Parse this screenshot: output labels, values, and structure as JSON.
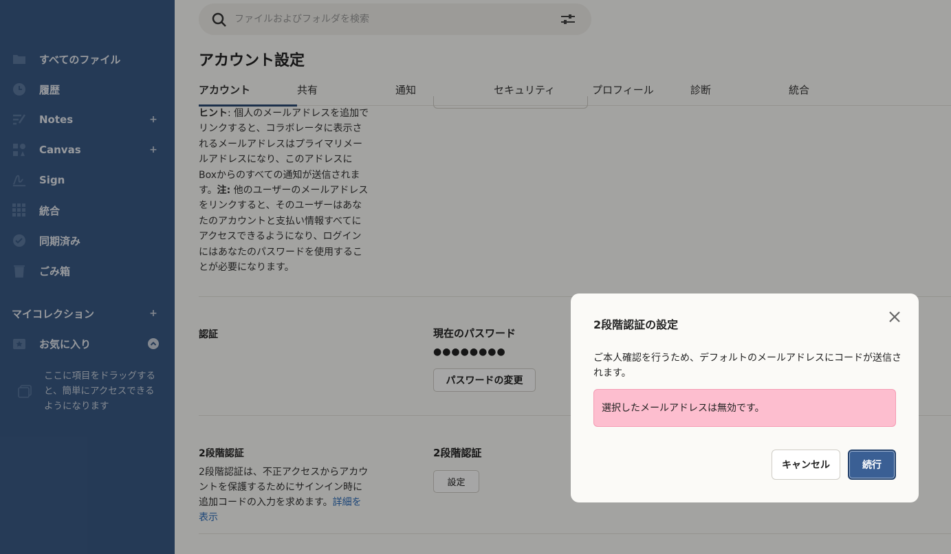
{
  "sidebar": {
    "items": [
      {
        "label": "すべてのファイル",
        "icon": "folder-icon"
      },
      {
        "label": "履歴",
        "icon": "clock-icon"
      },
      {
        "label": "Notes",
        "icon": "notes-icon",
        "plus": "+"
      },
      {
        "label": "Canvas",
        "icon": "canvas-icon",
        "plus": "+"
      },
      {
        "label": "Sign",
        "icon": "sign-icon"
      },
      {
        "label": "統合",
        "icon": "grid-icon"
      },
      {
        "label": "同期済み",
        "icon": "check-circle-icon"
      },
      {
        "label": "ごみ箱",
        "icon": "trash-icon"
      }
    ],
    "collections_title": "マイコレクション",
    "collections_plus": "+",
    "favorites_label": "お気に入り",
    "favorites_hint": "ここに項目をドラッグすると、簡単にアクセスできるようになります"
  },
  "search": {
    "placeholder": "ファイルおよびフォルダを検索"
  },
  "main": {
    "title": "アカウント設定",
    "tabs": [
      "アカウント",
      "共有",
      "通知",
      "セキュリティ",
      "プロフィール",
      "診断",
      "統合"
    ],
    "hint": {
      "label": "ヒント",
      "text1": ": 個人のメールアドレスを追加でリンクすると、コラボレータに表示されるメールアドレスはプライマリメールアドレスになり、このアドレスにBoxからのすべての通知が送信されます。",
      "note_label": "注:",
      "text2": " 他のユーザーのメールアドレスをリンクすると、そのユーザーはあなたのアカウントと支払い情報すべてにアクセスできるようになり、ログインにはあなたのパスワードを使用することが必要になります。"
    },
    "auth": {
      "label": "認証",
      "current_password_label": "現在のパスワード",
      "password_dots": "●●●●●●●●",
      "change_password_button": "パスワードの変更"
    },
    "twofa": {
      "label": "2段階認証",
      "description": "2段階認証は、不正アクセスからアカウントを保護するためにサインイン時に追加コードの入力を求めます。",
      "learn_more": "詳細を表示",
      "col_label": "2段階認証",
      "setup_button": "設定"
    }
  },
  "modal": {
    "title": "2段階認証の設定",
    "body": "ご本人確認を行うため、デフォルトのメールアドレスにコードが送信されます。",
    "error": "選択したメールアドレスは無効です。",
    "cancel_label": "キャンセル",
    "continue_label": "続行"
  },
  "colors": {
    "sidebar_bg": "#3a5a85",
    "error_bg": "#fdbecf",
    "primary_button": "#3a5f94",
    "link": "#2a6bb8"
  }
}
